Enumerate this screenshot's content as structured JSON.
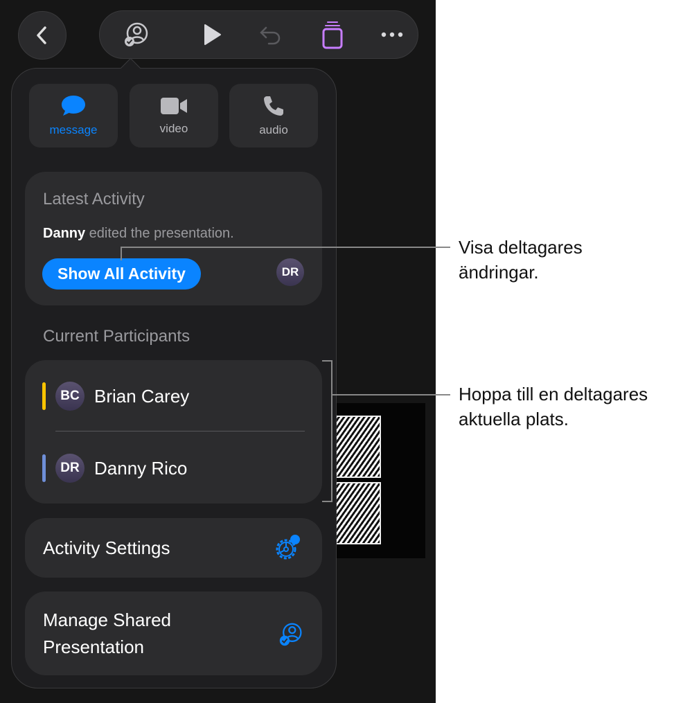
{
  "comm": {
    "message": "message",
    "video": "video",
    "audio": "audio"
  },
  "latest_activity": {
    "title": "Latest Activity",
    "user": "Danny",
    "text": " edited the presentation.",
    "button": "Show All Activity",
    "avatar": "DR"
  },
  "participants": {
    "title": "Current Participants",
    "list": [
      {
        "initials": "BC",
        "name": "Brian Carey",
        "color": "#ffc400"
      },
      {
        "initials": "DR",
        "name": "Danny Rico",
        "color": "#6f8fd8"
      }
    ]
  },
  "activity_settings": "Activity Settings",
  "manage": {
    "line1": "Manage Shared",
    "line2": "Presentation"
  },
  "callouts": {
    "c1": [
      "Visa deltagares",
      "ändringar."
    ],
    "c2": [
      "Hoppa till en deltagares",
      "aktuella plats."
    ]
  },
  "colors": {
    "accent": "#0a84ff",
    "purple": "#c77dff"
  }
}
